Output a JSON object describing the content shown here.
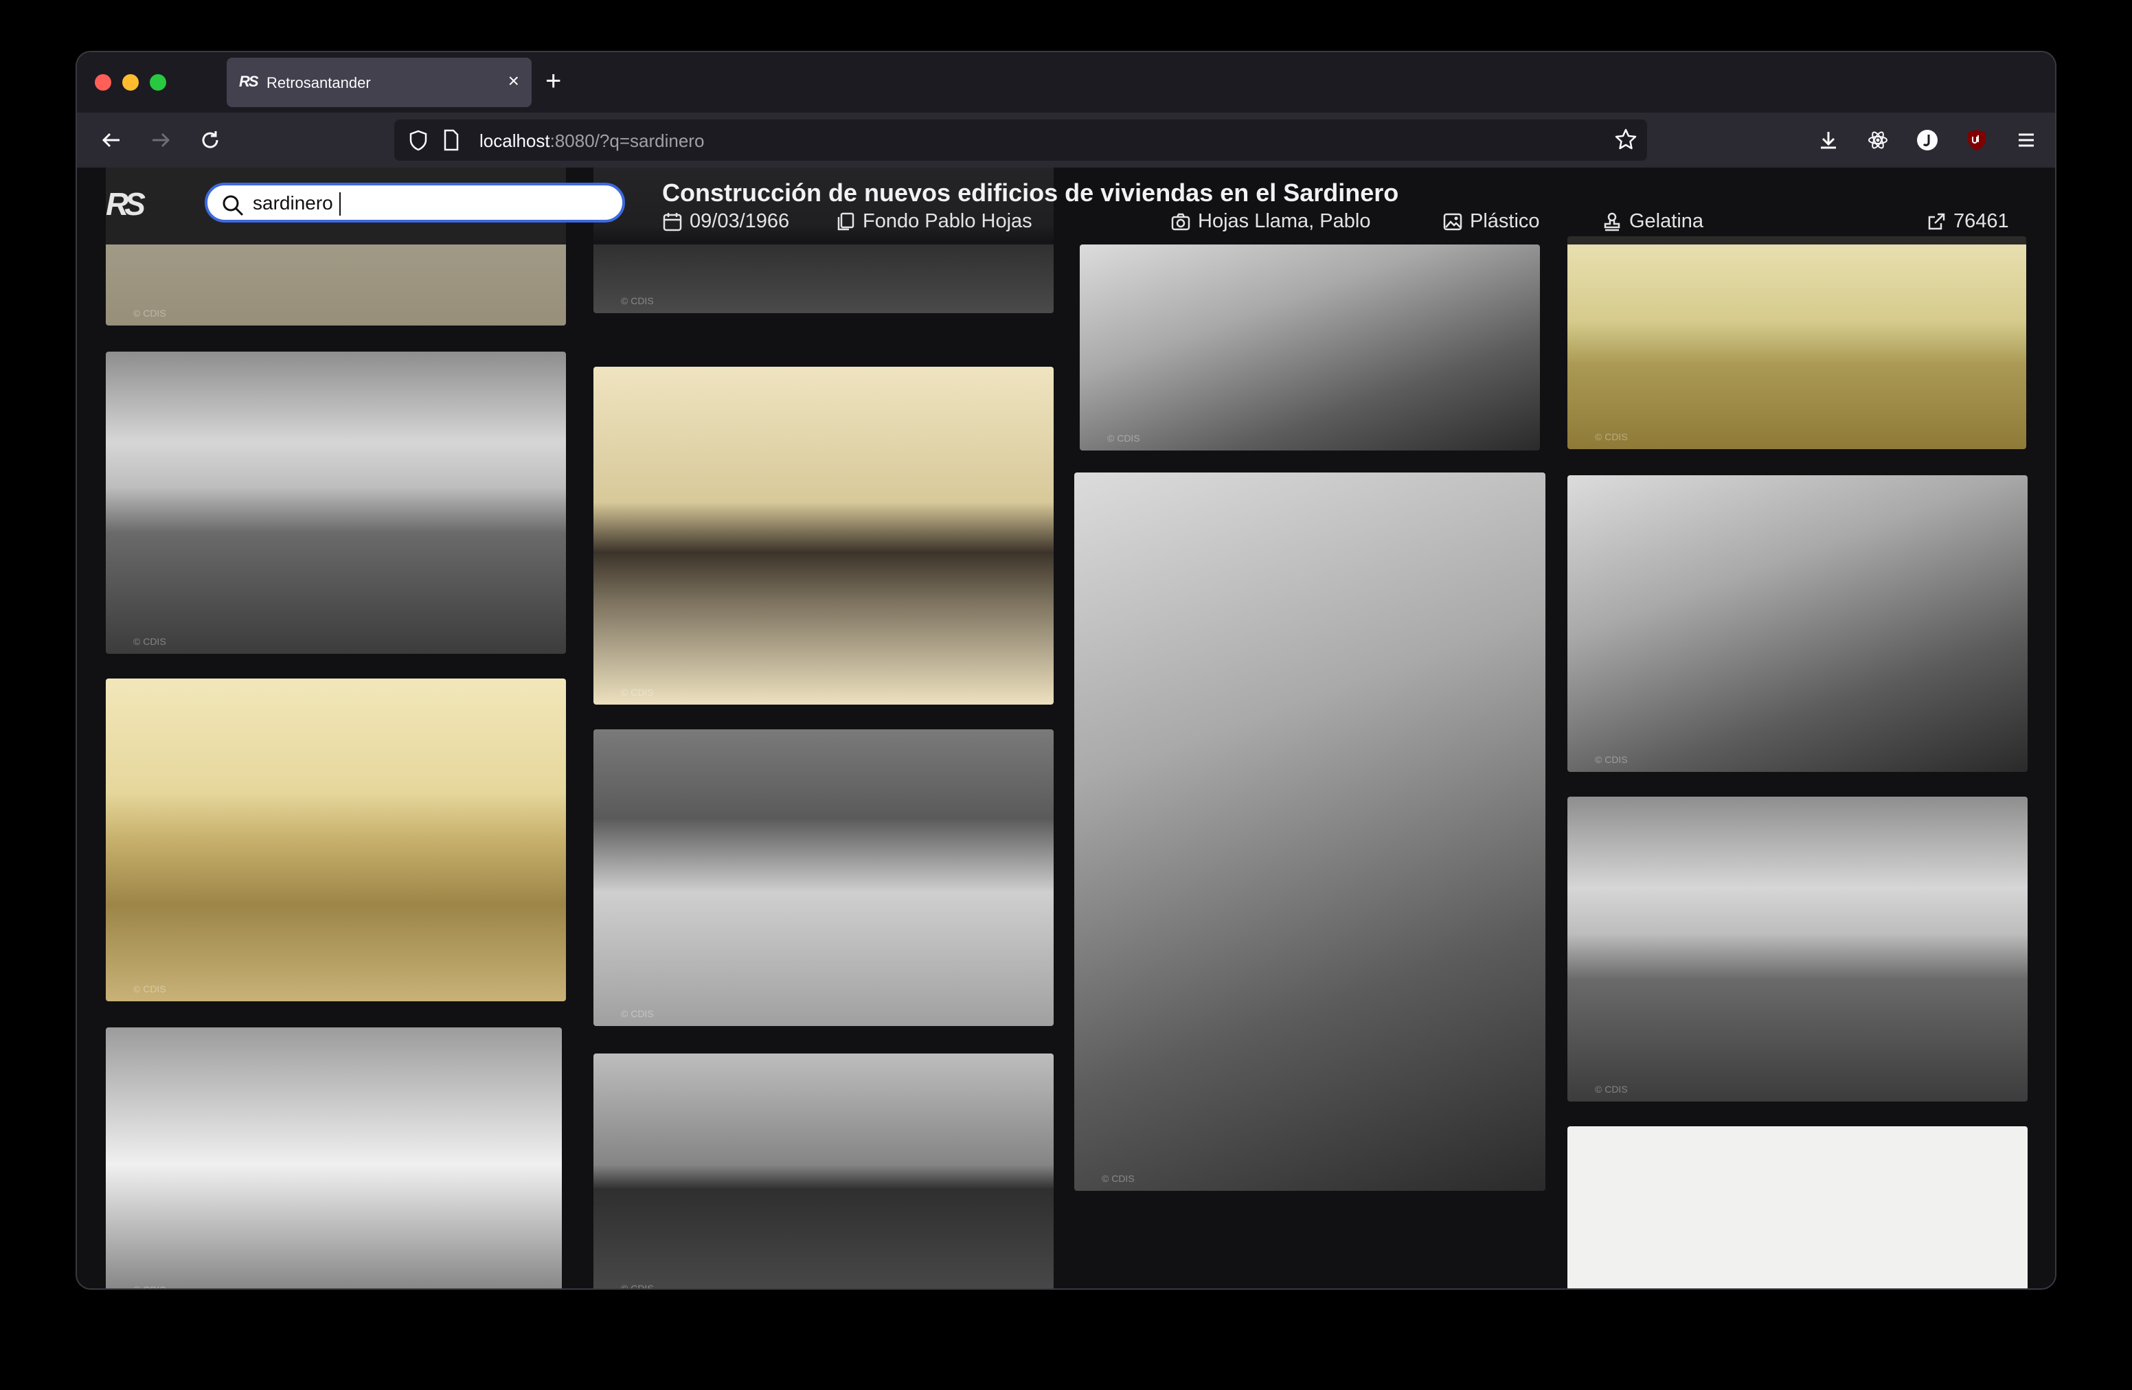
{
  "browser": {
    "tab_title": "Retrosantander",
    "tab_icon_text": "RS",
    "new_tab_symbol": "+",
    "close_symbol": "×",
    "url_host": "localhost",
    "url_rest": ":8080/?q=sardinero"
  },
  "app": {
    "logo": "RS",
    "search_value": "sardinero"
  },
  "selected_photo": {
    "title": "Construcción de nuevos edificios de viviendas en el Sardinero",
    "date": "09/03/1966",
    "collection": "Fondo Pablo Hojas",
    "author": "Hojas Llama, Pablo",
    "support": "Plástico",
    "process": "Gelatina",
    "id": "76461"
  },
  "icons": {
    "back": "arrow-left-icon",
    "forward": "arrow-right-icon",
    "reload": "reload-icon",
    "shield": "shield-icon",
    "page": "page-icon",
    "bookmark": "star-icon",
    "download": "download-icon",
    "extension": "atom-icon",
    "account": "account-icon",
    "ublock": "ublock-icon",
    "menu": "hamburger-menu-icon",
    "search": "search-icon",
    "date": "calendar-icon",
    "collection": "copy-icon",
    "author": "camera-icon",
    "support": "image-icon",
    "process": "stamp-icon",
    "id": "external-link-icon"
  },
  "colors": {
    "page_bg": "#111114",
    "search_border": "#3d6ae0",
    "chrome_bg": "#1c1b22",
    "nav_bg": "#2b2a33"
  }
}
